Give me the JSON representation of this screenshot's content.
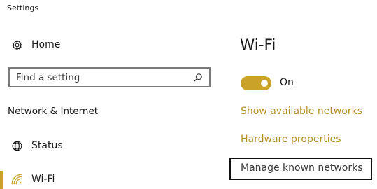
{
  "window": {
    "title": "Settings"
  },
  "nav": {
    "home_label": "Home",
    "home_icon": "gear-icon",
    "search": {
      "placeholder": "Find a setting",
      "value": "",
      "icon": "search-icon"
    },
    "section_title": "Network & Internet",
    "items": [
      {
        "label": "Status",
        "icon": "globe-icon",
        "selected": false
      },
      {
        "label": "Wi-Fi",
        "icon": "wifi-icon",
        "selected": true
      }
    ]
  },
  "main": {
    "title": "Wi-Fi",
    "wifi_toggle": {
      "state": "on",
      "label": "On"
    },
    "links": {
      "show_networks": "Show available networks",
      "hardware_properties": "Hardware properties",
      "manage_known": "Manage known networks"
    }
  },
  "colors": {
    "accent": "#c9a227",
    "link": "#b39024",
    "text": "#1a1a1a",
    "border": "#7a7a7a",
    "focus_frame": "#111111"
  }
}
